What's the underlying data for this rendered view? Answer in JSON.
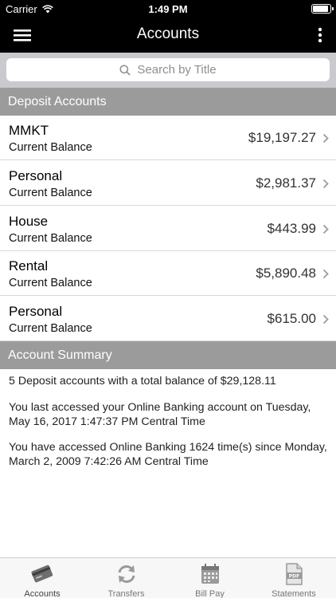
{
  "status_bar": {
    "carrier": "Carrier",
    "time": "1:49 PM"
  },
  "nav": {
    "title": "Accounts"
  },
  "search": {
    "placeholder": "Search by Title"
  },
  "deposit_section": {
    "title": "Deposit Accounts"
  },
  "accounts": [
    {
      "name": "MMKT",
      "subtitle": "Current Balance",
      "balance": "$19,197.27"
    },
    {
      "name": "Personal",
      "subtitle": "Current Balance",
      "balance": "$2,981.37"
    },
    {
      "name": "House",
      "subtitle": "Current Balance",
      "balance": "$443.99"
    },
    {
      "name": "Rental",
      "subtitle": "Current Balance",
      "balance": "$5,890.48"
    },
    {
      "name": "Personal",
      "subtitle": "Current Balance",
      "balance": "$615.00"
    }
  ],
  "summary_section": {
    "title": "Account Summary",
    "lines": [
      "5 Deposit accounts with a total balance of $29,128.11",
      "You last accessed your Online Banking account on Tuesday, May 16, 2017 1:47:37 PM Central Time",
      "You have accessed Online Banking 1624 time(s) since Monday, March 2, 2009 7:42:26 AM Central Time"
    ]
  },
  "tabs": [
    {
      "label": "Accounts",
      "icon": "accounts-card-icon"
    },
    {
      "label": "Transfers",
      "icon": "transfers-arrows-icon"
    },
    {
      "label": "Bill Pay",
      "icon": "calendar-icon"
    },
    {
      "label": "Statements",
      "icon": "pdf-document-icon"
    }
  ]
}
